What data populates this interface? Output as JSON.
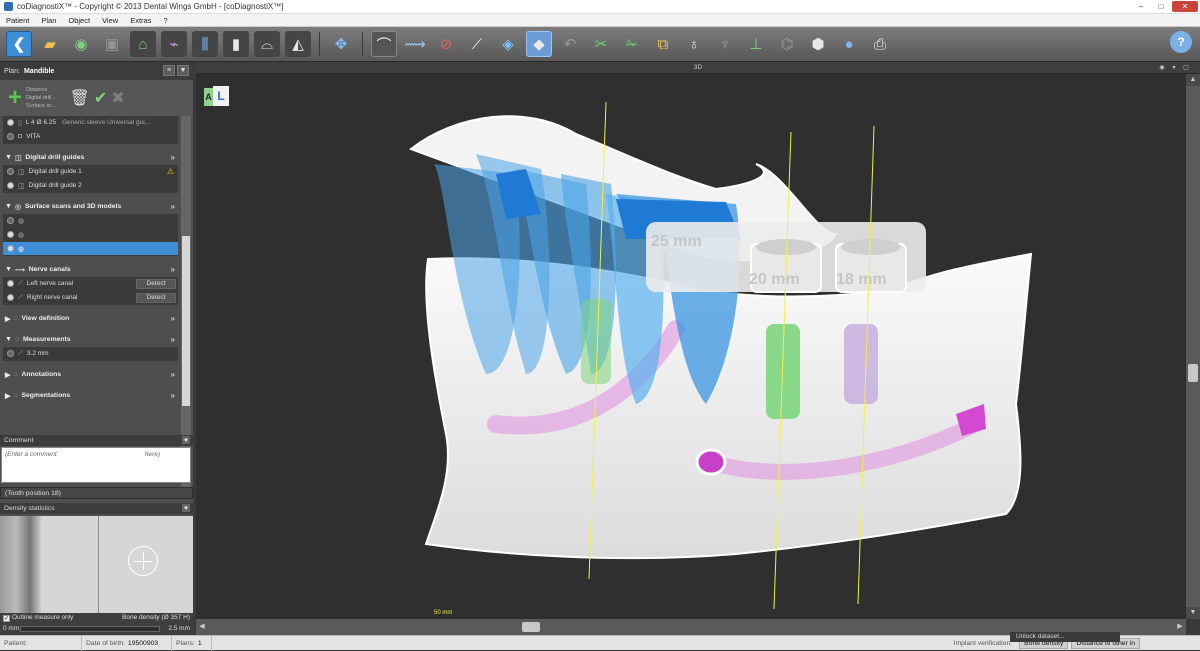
{
  "window": {
    "title": "coDiagnostiX™ - Copyright © 2013 Dental Wings GmbH - [coDiagnostiX™]",
    "min": "–",
    "max": "□",
    "close": "✕"
  },
  "menu": [
    "Patient",
    "Plan",
    "Object",
    "View",
    "Extras",
    "?"
  ],
  "toolbar": {
    "back_glyph": "❮",
    "help_glyph": "?"
  },
  "plan": {
    "label": "Plan:",
    "name": "Mandible",
    "menu_glyph": "≡",
    "collapse_glyph": "▼",
    "add_glyph": "+",
    "hints": [
      "Distance",
      "Digital drill ...",
      "Surface sc..."
    ]
  },
  "implants": {
    "items": [
      {
        "label": "L 4  Ø 6.25",
        "extra": "Generic sleeve Universal gui..."
      },
      {
        "label": "VITA"
      }
    ]
  },
  "sections": {
    "drill_guides": {
      "title": "Digital drill guides",
      "items": [
        {
          "label": "Digital drill guide 1",
          "warn": "⚠"
        },
        {
          "label": "Digital drill guide 2"
        }
      ]
    },
    "surface_scans": {
      "title": "Surface scans and 3D models"
    },
    "nerve_canals": {
      "title": "Nerve canals",
      "items": [
        {
          "label": "Left nerve canal",
          "button": "Detect"
        },
        {
          "label": "Right nerve canal",
          "button": "Detect"
        }
      ]
    },
    "view_definition": {
      "title": "View definition"
    },
    "measurements": {
      "title": "Measurements",
      "items": [
        {
          "label": "3.2 mm"
        }
      ]
    },
    "annotations": {
      "title": "Annotations"
    },
    "segmentations": {
      "title": "Segmentations"
    }
  },
  "comment": {
    "title": "Comment",
    "placeholder": "(Enter a comment",
    "placeholder_tail": "here)"
  },
  "tooth_position": "(Tooth position 18)",
  "density": {
    "title": "Density statistics",
    "outline_label": "Outline measure only",
    "bone_density": "Bone density (Ø 357 H)",
    "min": "0 mm",
    "max": "2.5 mm",
    "outline_checked": true
  },
  "viewport": {
    "title": "3D",
    "view_cube_labels": [
      "A",
      "L"
    ],
    "scale_label": "50 mm",
    "guide_labels": [
      "25 mm",
      "20 mm",
      "18 mm"
    ]
  },
  "status": {
    "patient_label": "Patient:",
    "patient_value": "",
    "dob_label": "Date of birth:",
    "dob_value": "19500903",
    "plans_label": "Plans:",
    "plans_value": "1",
    "verify_label": "Implant verification:",
    "bone_density_chip": "Bone density",
    "distance_chip": "Distance to other in",
    "unlock_tip": "Unlock dataset..."
  },
  "colors": {
    "accent": "#3d8ed6",
    "teeth": "#4aa3e6",
    "implant_green": "#7ed67e",
    "implant_lilac": "#c9b2e0",
    "nerve": "#e3a5e3",
    "axis": "#f0f04a"
  }
}
